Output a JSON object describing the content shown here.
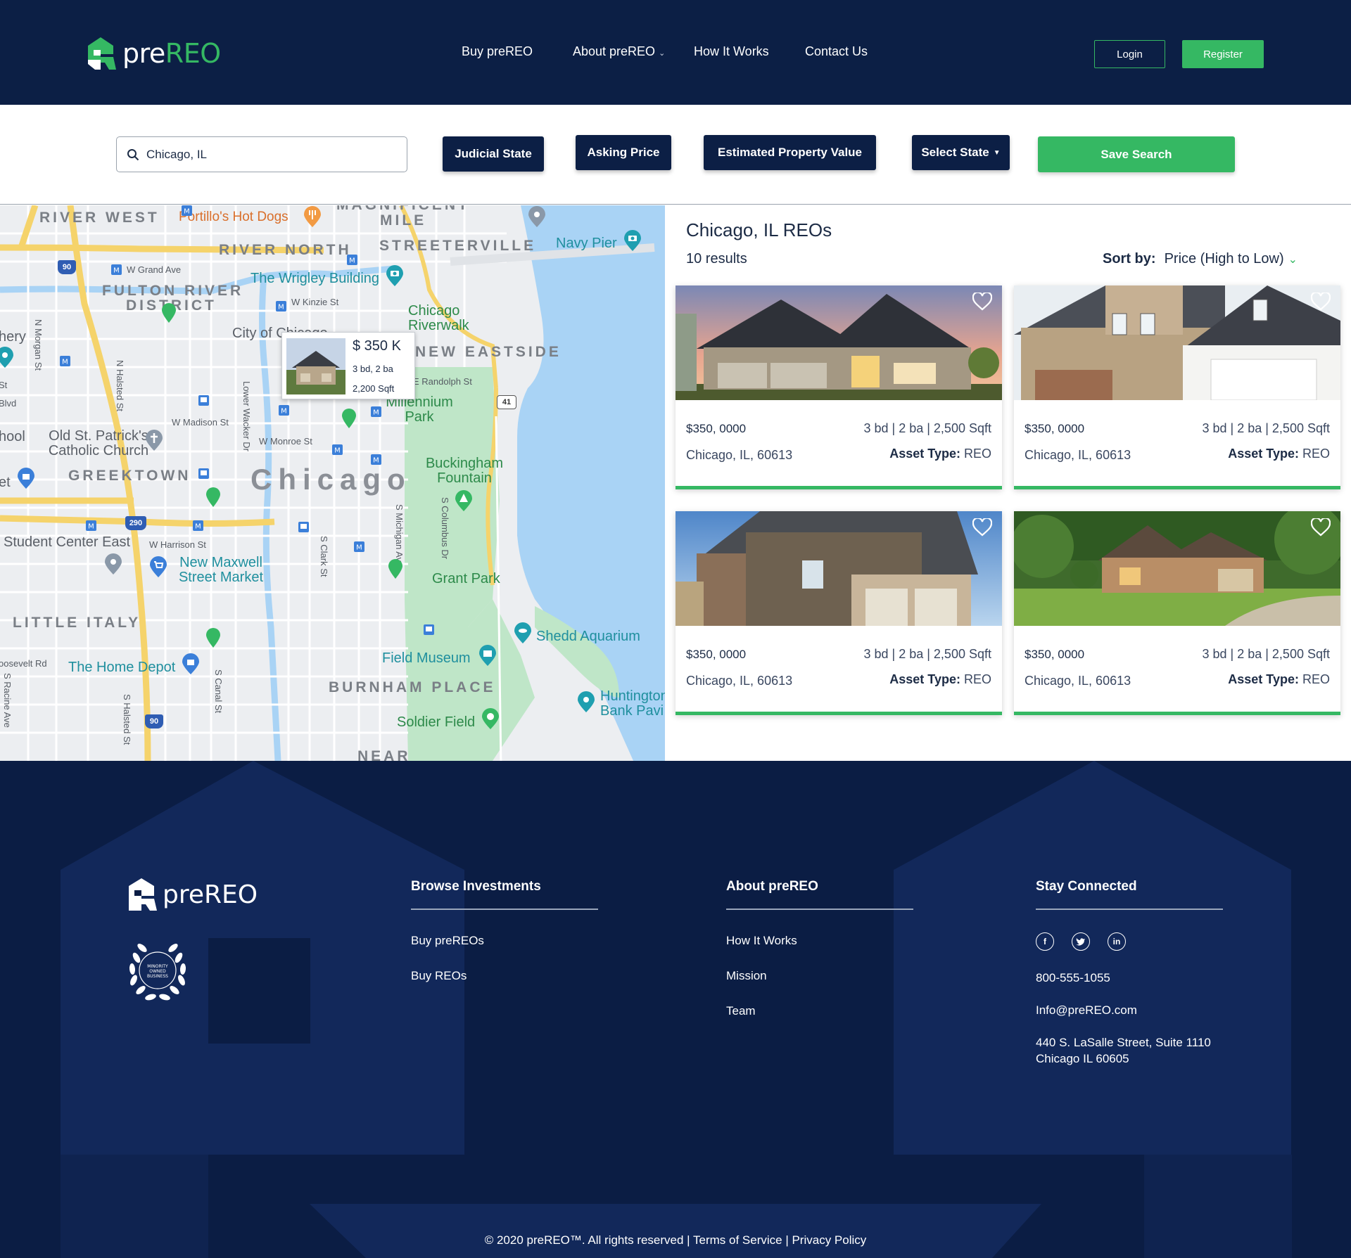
{
  "brand": {
    "name_pre": "pre",
    "name_reo": "REO",
    "accent": "#35b863",
    "navy": "#0c1f45"
  },
  "nav": {
    "items": [
      {
        "label": "Buy preREO"
      },
      {
        "label": "About preREO",
        "has_dropdown": true
      },
      {
        "label": "How It Works"
      },
      {
        "label": "Contact Us"
      }
    ],
    "login_label": "Login",
    "register_label": "Register"
  },
  "search": {
    "value": "Chicago, IL",
    "filters": [
      "Judicial State",
      "Asking Price",
      "Estimated Property Value",
      "Select State"
    ],
    "save_label": "Save Search"
  },
  "map": {
    "districts": [
      "RIVER WEST",
      "RIVER NORTH",
      "STREETERVILLE",
      "FULTON RIVER",
      "DISTRICT",
      "NEW EASTSIDE",
      "GREEKTOWN",
      "LITTLE ITALY",
      "BURNHAM PLACE",
      "MAGNIFICENT",
      "MILE",
      "NEAR"
    ],
    "pois": [
      "Portillo's Hot Dogs",
      "Navy Pier",
      "The Wrigley Building",
      "Chicago Riverwalk",
      "City of Chicago",
      "Millennium Park",
      "Old St. Patrick's Catholic Church",
      "Buckingham Fountain",
      "Student Center East",
      "New Maxwell Street Market",
      "Grant Park",
      "Shedd Aquarium",
      "Field Museum",
      "The Home Depot",
      "Soldier Field",
      "Huntington Bank Pavi",
      "hery",
      "hool",
      "et"
    ],
    "streets": [
      "W Grand Ave",
      "W Kinzie St",
      "N Morgan St",
      "N Halsted St",
      "W Madison St",
      "Lower Wacker Dr",
      "W Monroe St",
      "E Randolph St",
      "W Harrison St",
      "S Clark St",
      "S Michigan Av",
      "S Columbus Dr",
      "S Canal St",
      "S Halsted St",
      "S Racine Ave",
      "oosevelt Rd",
      "St",
      "Blvd"
    ],
    "highway_shields": [
      "90",
      "290",
      "41",
      "90"
    ],
    "city_label": "Chicago",
    "popup": {
      "price": "$ 350 K",
      "beds": "3 bd, 2 ba",
      "sqft": "2,200 Sqft"
    }
  },
  "results": {
    "title": "Chicago, IL REOs",
    "count": "10 results",
    "sort_label": "Sort by:",
    "sort_value": "Price (High to Low)",
    "cards": [
      {
        "price": "$350, 0000",
        "specs": "3 bd | 2 ba | 2,500 Sqft",
        "address": "Chicago, IL, 60613",
        "asset_label": "Asset Type:",
        "asset_value": "REO"
      },
      {
        "price": "$350, 0000",
        "specs": "3 bd | 2 ba | 2,500 Sqft",
        "address": "Chicago, IL, 60613",
        "asset_label": "Asset Type:",
        "asset_value": "REO"
      },
      {
        "price": "$350, 0000",
        "specs": "3 bd | 2 ba | 2,500 Sqft",
        "address": "Chicago, IL, 60613",
        "asset_label": "Asset Type:",
        "asset_value": "REO"
      },
      {
        "price": "$350, 0000",
        "specs": "3 bd | 2 ba | 2,500 Sqft",
        "address": "Chicago, IL, 60613",
        "asset_label": "Asset Type:",
        "asset_value": "REO"
      }
    ]
  },
  "footer": {
    "logo_text": "preREO",
    "badge_text": "MINORITY OWNED BUSINESS",
    "browse": {
      "title": "Browse Investments",
      "links": [
        "Buy preREOs",
        "Buy REOs"
      ]
    },
    "about": {
      "title": "About preREO",
      "links": [
        "How It Works",
        "Mission",
        "Team"
      ]
    },
    "connect": {
      "title": "Stay Connected",
      "social": [
        "facebook",
        "twitter",
        "linkedin"
      ],
      "phone": "800-555-1055",
      "email": "Info@preREO.com",
      "address_line1": "440 S. LaSalle Street, Suite 1110",
      "address_line2": "Chicago IL 60605"
    },
    "copyright": "© 2020 preREO™. All rights reserved | Terms of Service | Privacy Policy"
  }
}
